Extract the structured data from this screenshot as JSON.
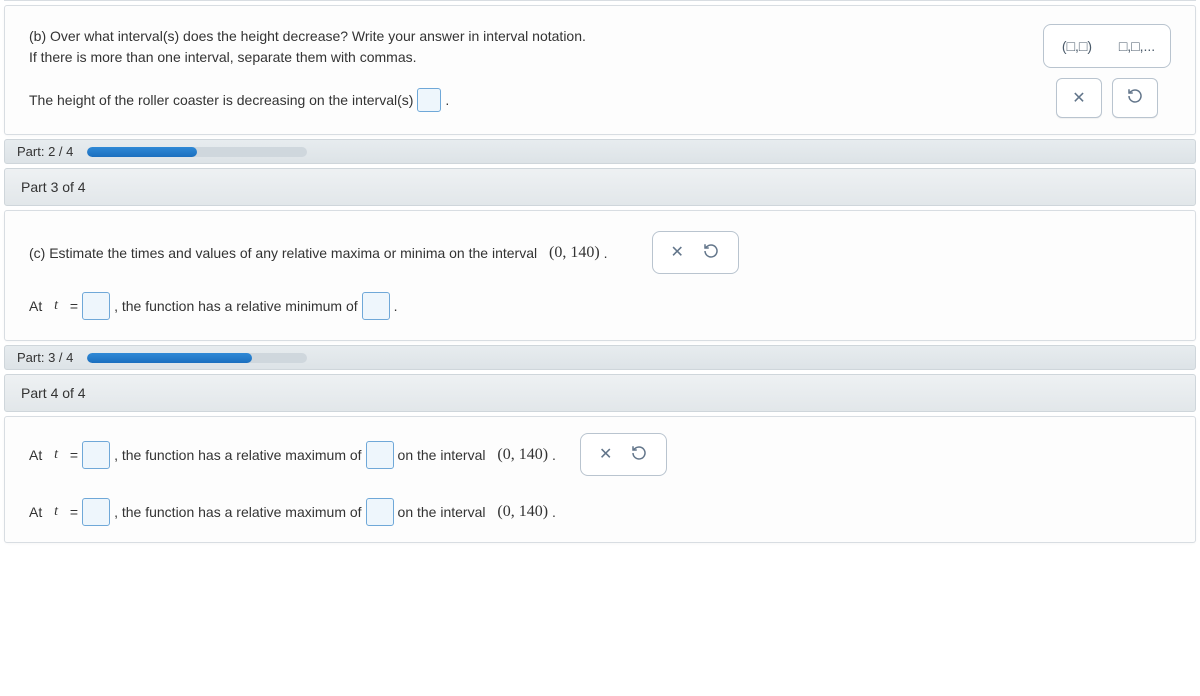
{
  "part_b": {
    "prompt_line1": "(b) Over what interval(s) does the height decrease? Write your answer in interval notation.",
    "prompt_line2": "If there is more than one interval, separate them with commas.",
    "answer_prefix": "The height of the roller coaster is decreasing on the interval(s)",
    "answer_suffix": ".",
    "palette": {
      "interval_open": "(□,□)",
      "list": "□,□,..."
    }
  },
  "progress1": {
    "label": "Part: 2 / 4",
    "pct": 50
  },
  "header3": "Part 3 of 4",
  "part_c": {
    "prompt": "(c) Estimate the times and values of any relative maxima or minima on the interval",
    "interval": "(0, 140)",
    "line1_a": "At",
    "line1_var": "t",
    "line1_eq": "=",
    "line1_b": ", the function has a relative minimum of",
    "suffix": "."
  },
  "progress2": {
    "label": "Part: 3 / 4",
    "pct": 75
  },
  "header4": "Part 4 of 4",
  "part_d": {
    "row_a": "At",
    "row_var": "t",
    "row_eq": "=",
    "row_b": ", the function has a relative maximum of",
    "row_c": "on the interval",
    "interval": "(0, 140)",
    "suffix": "."
  },
  "tools": {
    "clear": "clear",
    "reset": "reset"
  }
}
